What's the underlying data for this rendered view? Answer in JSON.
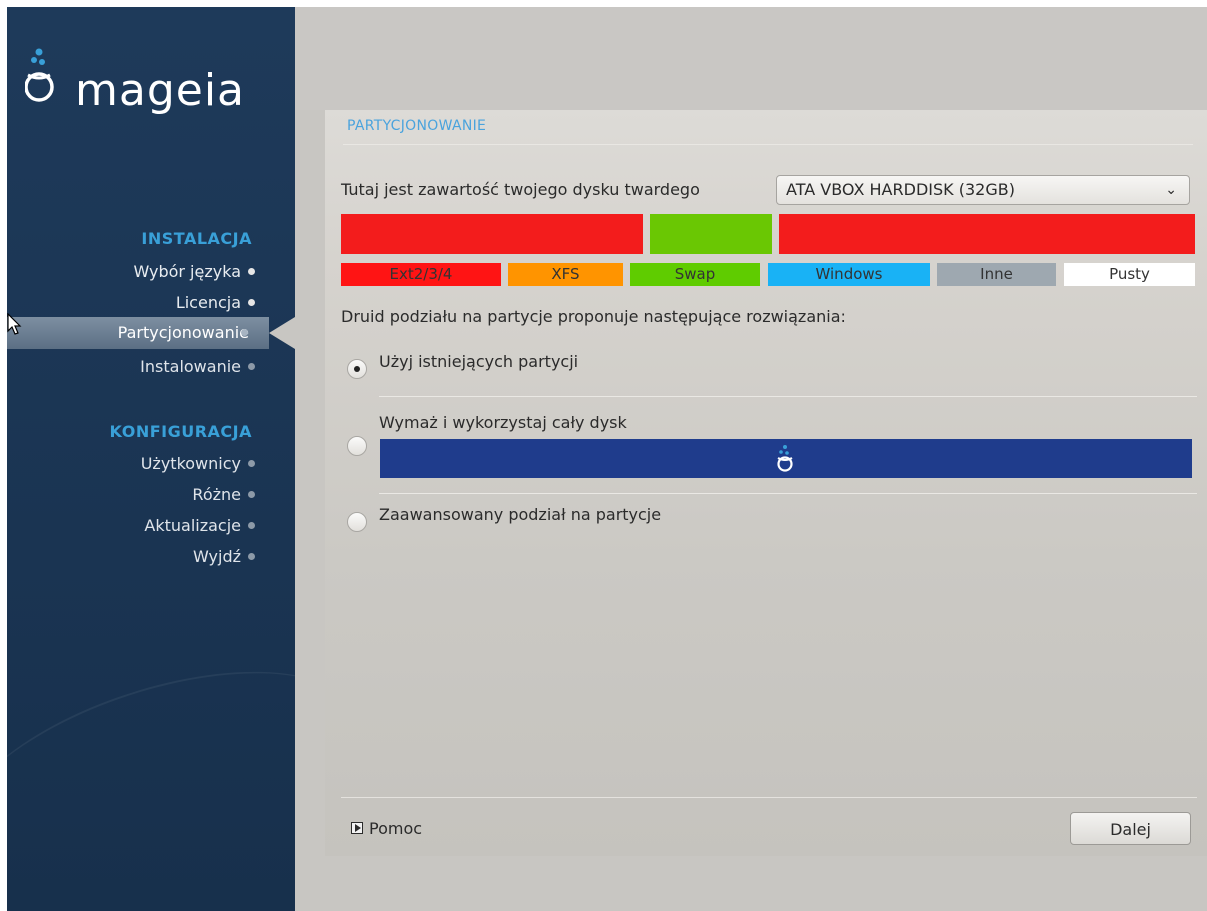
{
  "sidebar": {
    "logo_text": "mageia",
    "sections": [
      {
        "title": "INSTALACJA",
        "items": [
          {
            "label": "Wybór języka",
            "state": "done"
          },
          {
            "label": "Licencja",
            "state": "done"
          },
          {
            "label": "Partycjonowanie",
            "state": "active"
          },
          {
            "label": "Instalowanie",
            "state": "pending"
          }
        ]
      },
      {
        "title": "KONFIGURACJA",
        "items": [
          {
            "label": "Użytkownicy",
            "state": "pending"
          },
          {
            "label": "Różne",
            "state": "pending"
          },
          {
            "label": "Aktualizacje",
            "state": "pending"
          },
          {
            "label": "Wyjdź",
            "state": "pending"
          }
        ]
      }
    ]
  },
  "page": {
    "title": "PARTYCJONOWANIE",
    "disk_label": "Tutaj jest zawartość twojego dysku twardego",
    "disk_select": "ATA VBOX HARDDISK (32GB)",
    "partitions": [
      {
        "type": "Ext2/3/4",
        "color": "#f31c1c"
      },
      {
        "type": "Swap",
        "color": "#6ac703"
      },
      {
        "type": "Ext2/3/4",
        "color": "#f31c1c"
      }
    ],
    "legend": [
      {
        "label": "Ext2/3/4",
        "color": "#ff1414"
      },
      {
        "label": "XFS",
        "color": "#ff9400"
      },
      {
        "label": "Swap",
        "color": "#5fcc00"
      },
      {
        "label": "Windows",
        "color": "#19b2f5"
      },
      {
        "label": "Inne",
        "color": "#9ea8b0"
      },
      {
        "label": "Pusty",
        "color": "#ffffff"
      }
    ],
    "druid_text": "Druid podziału na partycje proponuje następujące rozwiązania:",
    "options": [
      {
        "label": "Użyj istniejących partycji",
        "selected": true
      },
      {
        "label": "Wymaż i wykorzystaj cały dysk",
        "selected": false
      },
      {
        "label": "Zaawansowany podział na partycje",
        "selected": false
      }
    ],
    "help_label": "Pomoc",
    "next_label": "Dalej"
  },
  "colors": {
    "sidebar_bg": "#1e3a5a",
    "accent": "#39a0d8",
    "erase_bar": "#1f3c8c"
  }
}
